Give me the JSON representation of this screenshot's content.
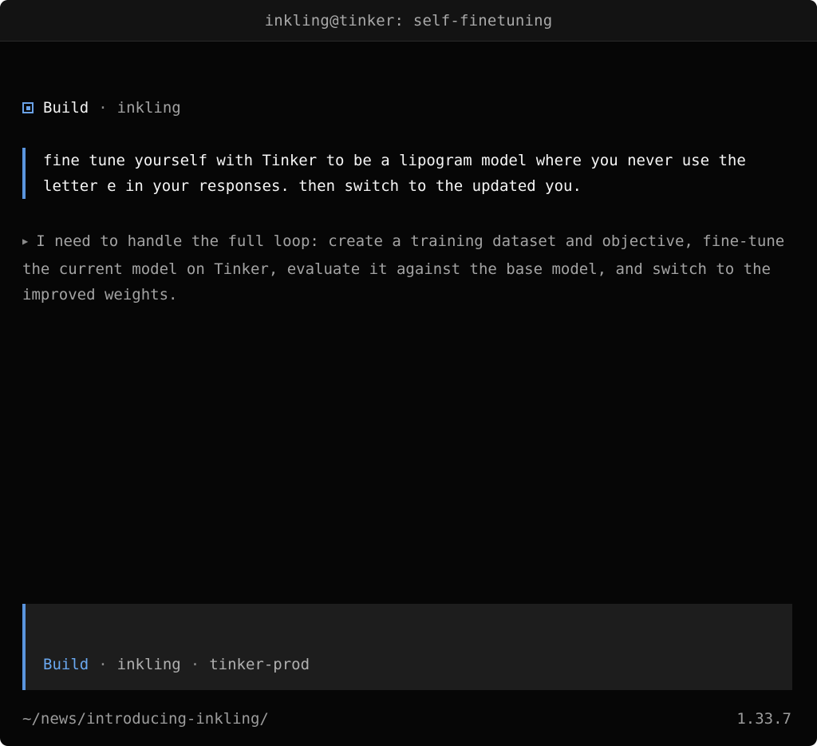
{
  "window": {
    "title": "inkling@tinker: self-finetuning"
  },
  "header": {
    "mode": "Build",
    "separator": "·",
    "agent": "inkling",
    "mode_icon": "square-icon"
  },
  "user_message": {
    "text": "fine tune yourself with Tinker to be a lipogram model where you never use the letter e in your responses. then switch to the updated you."
  },
  "thinking": {
    "arrow_icon": "triangle-right-icon",
    "text": "I need to handle the full loop: create a training dataset and objective, fine-tune the current model on Tinker, evaluate it against the base model, and switch to the improved weights."
  },
  "input": {
    "value": "",
    "status": {
      "mode": "Build",
      "separator": "·",
      "agent": "inkling",
      "environment": "tinker-prod"
    }
  },
  "footer": {
    "path": "~/news/introducing-inkling/",
    "version": "1.33.7"
  },
  "colors": {
    "background": "#060606",
    "accent": "#5a95de",
    "titlebar": "#131313",
    "input_background": "#1d1d1d"
  }
}
